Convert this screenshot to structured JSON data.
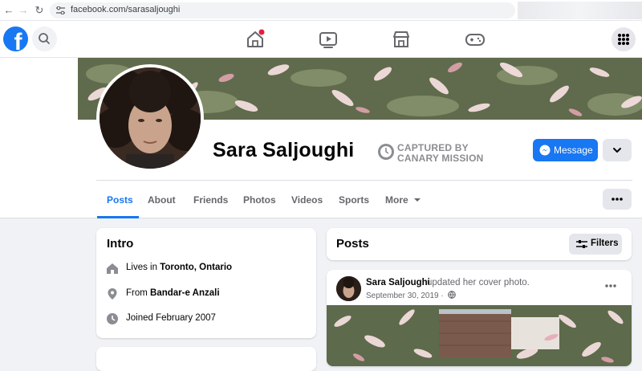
{
  "browser": {
    "url": "facebook.com/sarasaljoughi"
  },
  "topbar": {
    "logo_letter": "f"
  },
  "profile": {
    "name": "Sara Saljoughi",
    "stamp_line1": "CAPTURED BY",
    "stamp_line2": "CANARY MISSION",
    "message_label": "Message"
  },
  "tabs": [
    {
      "label": "Posts",
      "active": true
    },
    {
      "label": "About"
    },
    {
      "label": "Friends"
    },
    {
      "label": "Photos"
    },
    {
      "label": "Videos"
    },
    {
      "label": "Sports"
    },
    {
      "label": "More"
    }
  ],
  "intro": {
    "title": "Intro",
    "lives_prefix": "Lives in ",
    "lives_value": "Toronto, Ontario",
    "from_prefix": "From ",
    "from_value": "Bandar-e Anzali",
    "joined": "Joined February 2007"
  },
  "posts_header": {
    "title": "Posts",
    "filters_label": "Filters"
  },
  "post": {
    "author": "Sara Saljoughi",
    "action": "updated her cover photo.",
    "date": "September 30, 2019 ·"
  },
  "colors": {
    "brand_blue": "#1877f2",
    "notification_red": "#e41e3f",
    "page_bg": "#f0f2f5"
  }
}
